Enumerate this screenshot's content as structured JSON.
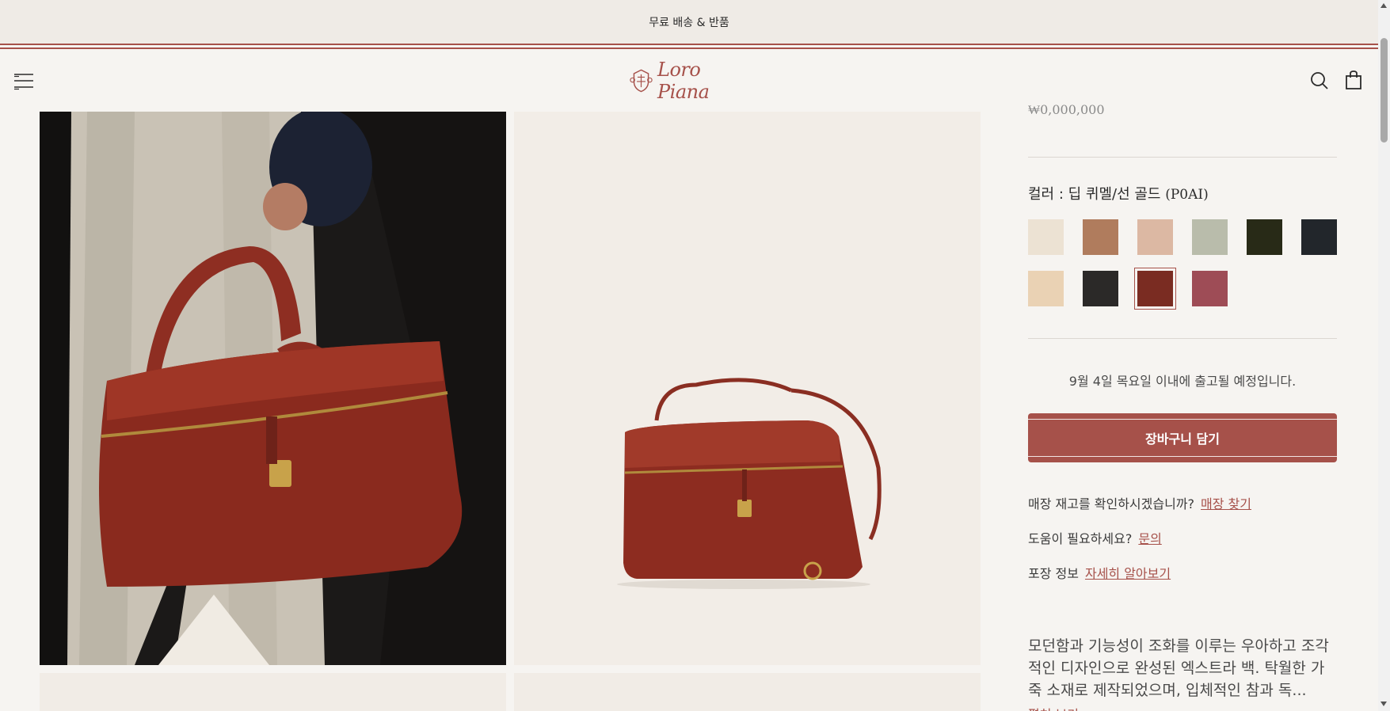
{
  "promo": {
    "text": "무료 배송 & 반품"
  },
  "header": {
    "brand": "Loro Piana",
    "icons": [
      "menu-icon",
      "search-icon",
      "shopping-bag-icon"
    ]
  },
  "product": {
    "price_partial": "₩0,000,000",
    "color_label": "컬러 : 딥 퀴멜/선 골드",
    "color_code": "(P0AI)",
    "swatches": [
      {
        "name": "ivory",
        "color": "#ece2d3"
      },
      {
        "name": "caramel",
        "color": "#b07c5d"
      },
      {
        "name": "blush",
        "color": "#dcb8a3"
      },
      {
        "name": "sage",
        "color": "#b9bcab"
      },
      {
        "name": "dark-olive",
        "color": "#282a17"
      },
      {
        "name": "charcoal",
        "color": "#22262b"
      },
      {
        "name": "light-beige",
        "color": "#ead2b4"
      },
      {
        "name": "black",
        "color": "#2b2928"
      },
      {
        "name": "deep-cumin",
        "color": "#7a2c22",
        "selected": true
      },
      {
        "name": "rose",
        "color": "#9e4c56"
      }
    ],
    "shipping_note": "9월 4일 목요일 이내에 출고될 예정입니다.",
    "add_to_cart": "장바구니 담기",
    "store_stock_q": "매장 재고를 확인하시겠습니까?",
    "store_stock_link": "매장 찾기",
    "help_q": "도움이 필요하세요?",
    "help_link": "문의",
    "packaging_q": "포장 정보",
    "packaging_link": "자세히 알아보기",
    "description": "모던함과 기능성이 조화를 이루는 우아하고 조각적인 디자인으로 완성된 엑스트라 백. 탁월한 가죽 소재로 제작되었으며, 입체적인 참과 독...",
    "description_more": "펼쳐 보기"
  },
  "colors": {
    "accent": "#a6514a",
    "background": "#f6f4f1",
    "promo_bg": "#efebe6"
  }
}
